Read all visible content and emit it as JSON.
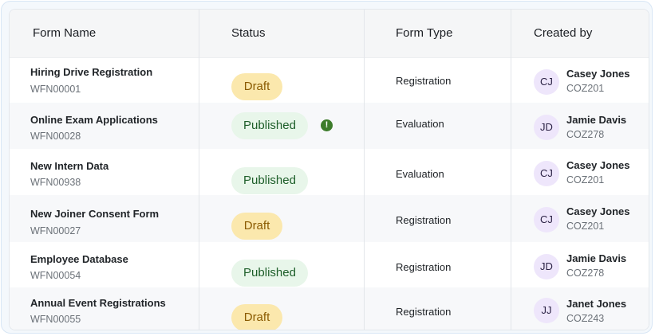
{
  "table": {
    "headers": [
      "Form Name",
      "Status",
      "Form Type",
      "Created by"
    ],
    "rows": [
      {
        "name": "Hiring Drive Registration",
        "id": "WFN00001",
        "status": "Draft",
        "type": "Registration",
        "initials": "CJ",
        "user": "Casey Jones",
        "user_code": "COZ201",
        "warning": false
      },
      {
        "name": "Online Exam Applications",
        "id": "WFN00028",
        "status": "Published",
        "type": "Evaluation",
        "initials": "JD",
        "user": "Jamie Davis",
        "user_code": "COZ278",
        "warning": true,
        "warning_glyph": "!"
      },
      {
        "name": "New Intern Data",
        "id": "WFN00938",
        "status": "Published",
        "type": "Evaluation",
        "initials": "CJ",
        "user": "Casey Jones",
        "user_code": "COZ201",
        "warning": false
      },
      {
        "name": "New Joiner Consent Form",
        "id": "WFN00027",
        "status": "Draft",
        "type": "Registration",
        "initials": "CJ",
        "user": "Casey Jones",
        "user_code": "COZ201",
        "warning": false
      },
      {
        "name": "Employee Database",
        "id": "WFN00054",
        "status": "Published",
        "type": "Registration",
        "initials": "JD",
        "user": "Jamie Davis",
        "user_code": "COZ278",
        "warning": false
      },
      {
        "name": "Annual Event Registrations",
        "id": "WFN00055",
        "status": "Draft",
        "type": "Registration",
        "initials": "JJ",
        "user": "Janet Jones",
        "user_code": "COZ243",
        "warning": false
      }
    ]
  },
  "icons": {
    "warning": "warning-icon"
  },
  "colors": {
    "draft_bg": "#fbe8ad",
    "draft_text": "#8a5a00",
    "published_bg": "#e8f6ea",
    "published_text": "#1d5e29",
    "warning": "#3d7c2b",
    "avatar_bg": "#eee6fb"
  }
}
